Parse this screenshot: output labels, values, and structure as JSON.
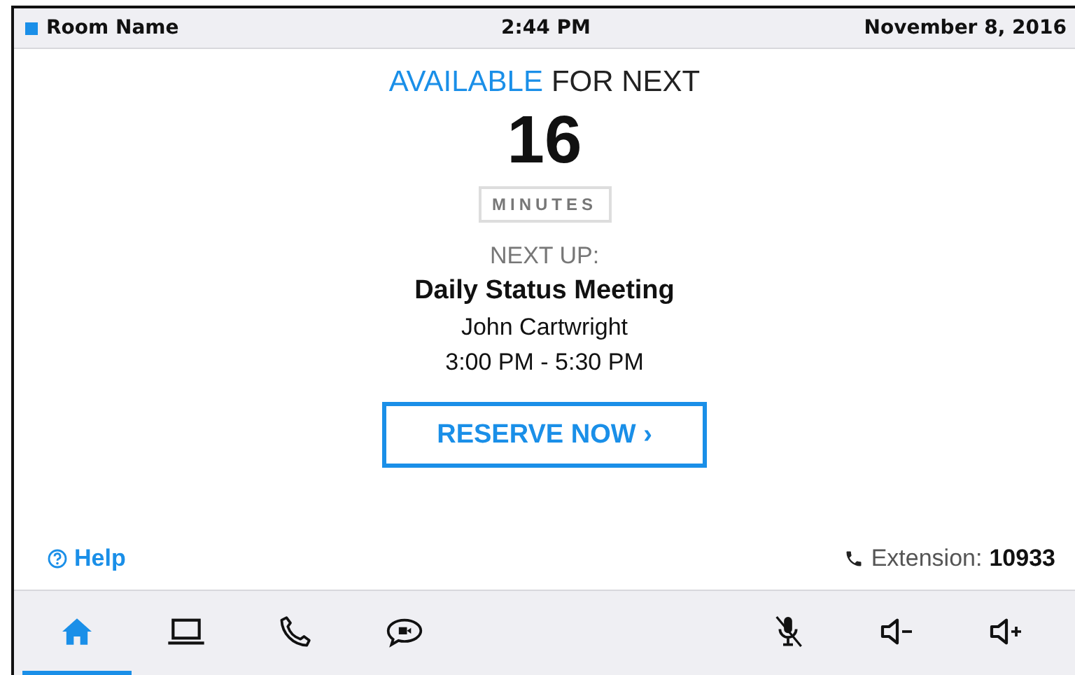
{
  "status_bar": {
    "room_name": "Room Name",
    "time": "2:44 PM",
    "date": "November 8, 2016"
  },
  "availability": {
    "status": "AVAILABLE",
    "suffix": "FOR NEXT",
    "count": "16",
    "unit": "MINUTES"
  },
  "next_up": {
    "label": "NEXT UP:",
    "title": "Daily Status Meeting",
    "organizer": "John Cartwright",
    "time": "3:00 PM - 5:30 PM"
  },
  "reserve_button": "RESERVE NOW ›",
  "help_link": "Help",
  "extension": {
    "label": "Extension:",
    "number": "10933"
  },
  "nav_bar": [
    {
      "kind": "home",
      "selected": true
    },
    {
      "kind": "laptop",
      "selected": false
    },
    {
      "kind": "phone",
      "selected": false
    },
    {
      "kind": "video-chat",
      "selected": false
    },
    {
      "kind": "mic-muted",
      "selected": false
    },
    {
      "kind": "volume-down",
      "selected": false
    },
    {
      "kind": "volume-up",
      "selected": false
    }
  ]
}
